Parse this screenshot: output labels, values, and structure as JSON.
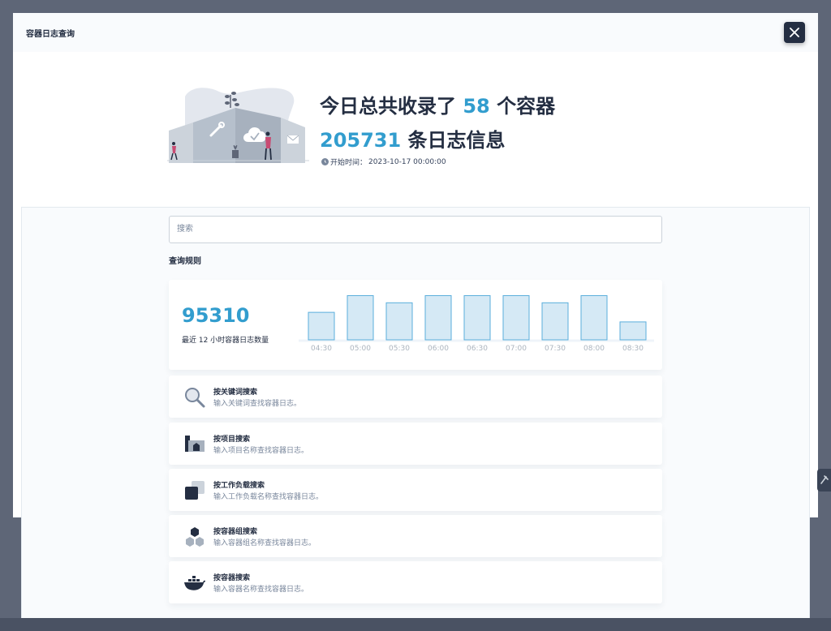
{
  "modal": {
    "title": "容器日志查询"
  },
  "hero": {
    "prefix1": "今日总共收录了 ",
    "container_count": "58",
    "suffix1": " 个容器",
    "log_count": "205731",
    "suffix2": " 条日志信息",
    "start_time_label": "开始时间：",
    "start_time": "2023-10-17 00:00:00"
  },
  "search": {
    "placeholder": "搜索"
  },
  "rules": {
    "title": "查询规则",
    "items": [
      {
        "title": "按关键词搜索",
        "desc": "输入关键词查找容器日志。",
        "icon": "magnifier-icon"
      },
      {
        "title": "按项目搜索",
        "desc": "输入项目名称查找容器日志。",
        "icon": "project-icon"
      },
      {
        "title": "按工作负载搜索",
        "desc": "输入工作负载名称查找容器日志。",
        "icon": "workload-icon"
      },
      {
        "title": "按容器组搜索",
        "desc": "输入容器组名称查找容器日志。",
        "icon": "pod-icon"
      },
      {
        "title": "按容器搜索",
        "desc": "输入容器名称查找容器日志。",
        "icon": "docker-icon"
      }
    ]
  },
  "stats": {
    "total": "95310",
    "label": "最近 12 小时容器日志数量"
  },
  "chart_data": {
    "type": "bar",
    "categories": [
      "04:30",
      "05:00",
      "05:30",
      "06:00",
      "06:30",
      "07:00",
      "07:30",
      "08:00",
      "08:30"
    ],
    "values": [
      11500,
      18500,
      15500,
      18500,
      18500,
      18500,
      15500,
      18500,
      7500
    ],
    "ylim": [
      0,
      19000
    ],
    "title": "",
    "xlabel": "",
    "ylabel": "",
    "grid": false,
    "colors": {
      "fill": "#d5e9f5",
      "stroke": "#5aaedc",
      "tick": "#abb4be"
    }
  },
  "colors": {
    "accent": "#329dce",
    "dark": "#242e42",
    "muted": "#79879c"
  }
}
